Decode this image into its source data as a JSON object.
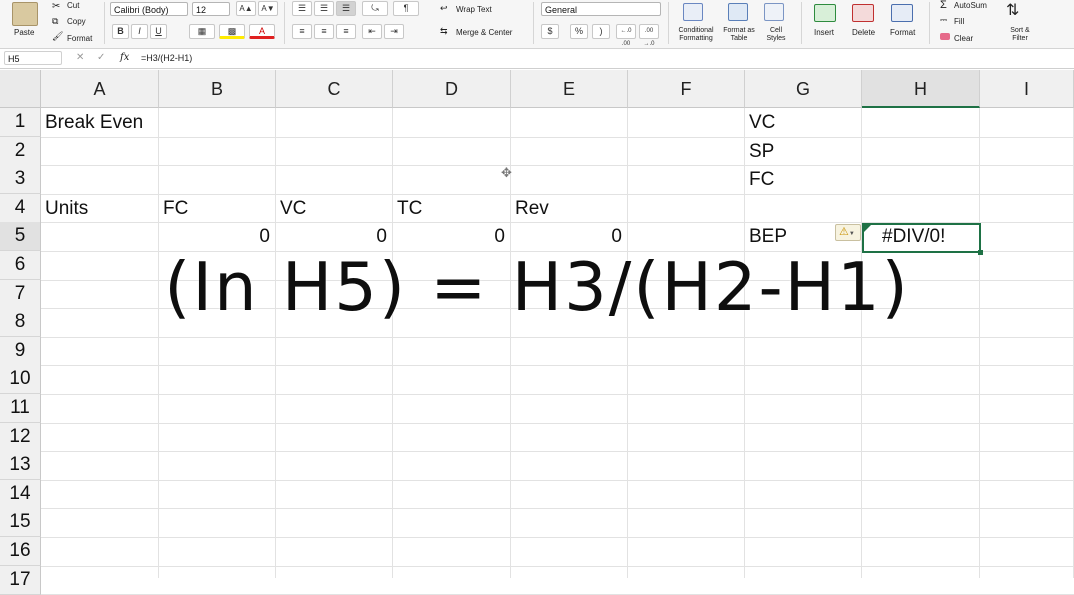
{
  "ribbon": {
    "clipboard": {
      "paste": "Paste",
      "cut": "Cut",
      "copy": "Copy",
      "format": "Format"
    },
    "font": {
      "family": "Calibri (Body)",
      "size": "12",
      "grow": "A▲",
      "shrink": "A▼",
      "bold": "B",
      "italic": "I",
      "underline": "U"
    },
    "alignment": {
      "wrap_text": "Wrap Text",
      "merge_center": "Merge & Center"
    },
    "number": {
      "format": "General",
      "currency": "$",
      "percent": "%",
      "comma": ")",
      "inc_decimal": "←.0 .00",
      "dec_decimal": ".00 →.0"
    },
    "styles": {
      "conditional_formatting": "Conditional Formatting",
      "format_as_table": "Format as Table",
      "cell_styles": "Cell Styles"
    },
    "cells": {
      "insert": "Insert",
      "delete": "Delete",
      "format": "Format"
    },
    "editing": {
      "autosum": "AutoSum",
      "fill": "Fill",
      "clear": "Clear",
      "sort_filter": "Sort & Filter"
    }
  },
  "formula_bar": {
    "name_box": "H5",
    "cancel": "✕",
    "enter": "✓",
    "fx": "fx",
    "formula": "=H3/(H2-H1)"
  },
  "columns": [
    "A",
    "B",
    "C",
    "D",
    "E",
    "F",
    "G",
    "H",
    "I"
  ],
  "rows": [
    "1",
    "2",
    "3",
    "4",
    "5",
    "6",
    "7",
    "8",
    "9",
    "10",
    "11",
    "12",
    "13",
    "14",
    "15",
    "16",
    "17"
  ],
  "cells": {
    "A1": "Break Even",
    "G1": "VC",
    "G2": "SP",
    "G3": "FC",
    "A4": "Units",
    "B4": "FC",
    "C4": "VC",
    "D4": "TC",
    "E4": "Rev",
    "B5": "0",
    "C5": "0",
    "D5": "0",
    "E5": "0",
    "G5": "BEP",
    "H5": "#DIV/0!"
  },
  "overlay_caption": "(In H5) = H3/(H2-H1)",
  "colors": {
    "accent": "#1e7145",
    "warning": "#f2c12e"
  }
}
